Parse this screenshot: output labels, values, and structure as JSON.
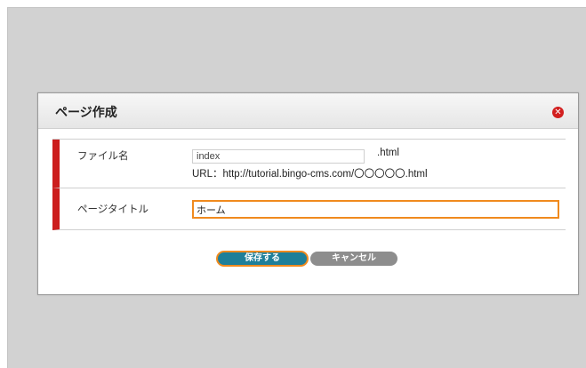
{
  "dialog": {
    "title": "ページ作成",
    "close_icon": "close-icon"
  },
  "form": {
    "filename_label": "ファイル名",
    "filename_value": "index",
    "filename_ext": ".html",
    "url_line": "URL：http://tutorial.bingo-cms.com/〇〇〇〇〇.html",
    "page_title_label": "ページタイトル",
    "page_title_value": "ホーム"
  },
  "buttons": {
    "save_label": "保存する",
    "cancel_label": "キャンセル"
  },
  "colors": {
    "accent_red": "#cc1d1d",
    "focus_orange": "#f08a1e",
    "save_blue": "#1f7f99",
    "cancel_gray": "#8d8d8d"
  }
}
